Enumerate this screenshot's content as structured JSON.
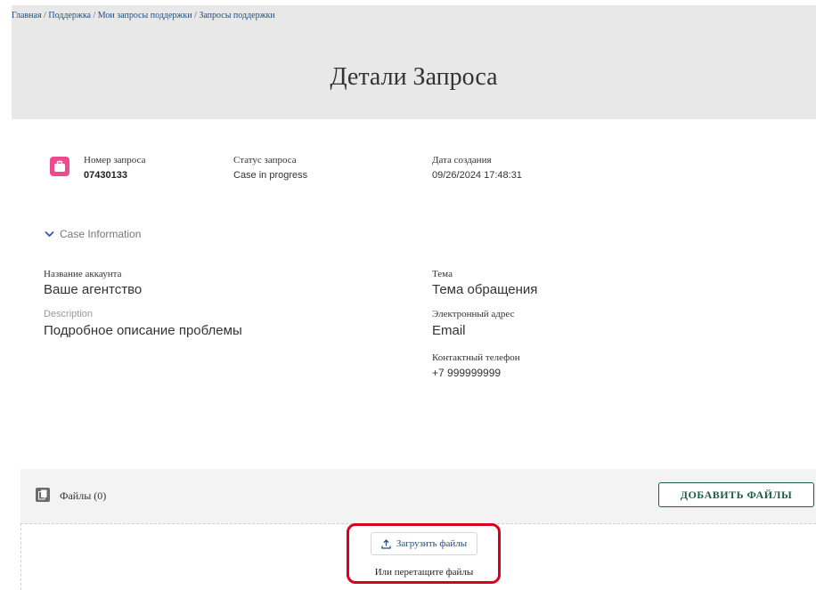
{
  "breadcrumb": {
    "items": [
      "Главная",
      "Поддержка",
      "Мои запросы поддержки",
      "Запросы поддержки"
    ],
    "separator": "/"
  },
  "page": {
    "title": "Детали Запроса"
  },
  "case_summary": {
    "icon": "briefcase-icon",
    "icon_color": "#f04a8c",
    "number_label": "Номер запроса",
    "number_value": "07430133",
    "status_label": "Статус запроса",
    "status_value": "Case in progress",
    "created_label": "Дата создания",
    "created_value": "09/26/2024 17:48:31"
  },
  "case_information": {
    "toggle_label": "Case Information",
    "account_label": "Название аккаунта",
    "account_value": "Ваше агентство",
    "description_label": "Description",
    "description_value": "Подробное описание проблемы",
    "subject_label": "Тема",
    "subject_value": "Тема обращения",
    "email_label": "Электронный адрес",
    "email_value": "Email",
    "phone_label": "Контактный телефон",
    "phone_value": "+7 999999999"
  },
  "files": {
    "title": "Файлы (0)",
    "add_button": "ДОБАВИТЬ ФАЙЛЫ",
    "upload_button": "Загрузить файлы",
    "drop_text": "Или перетащите файлы",
    "accent_color": "#1e5c4a",
    "highlight_color": "#d8001c"
  }
}
